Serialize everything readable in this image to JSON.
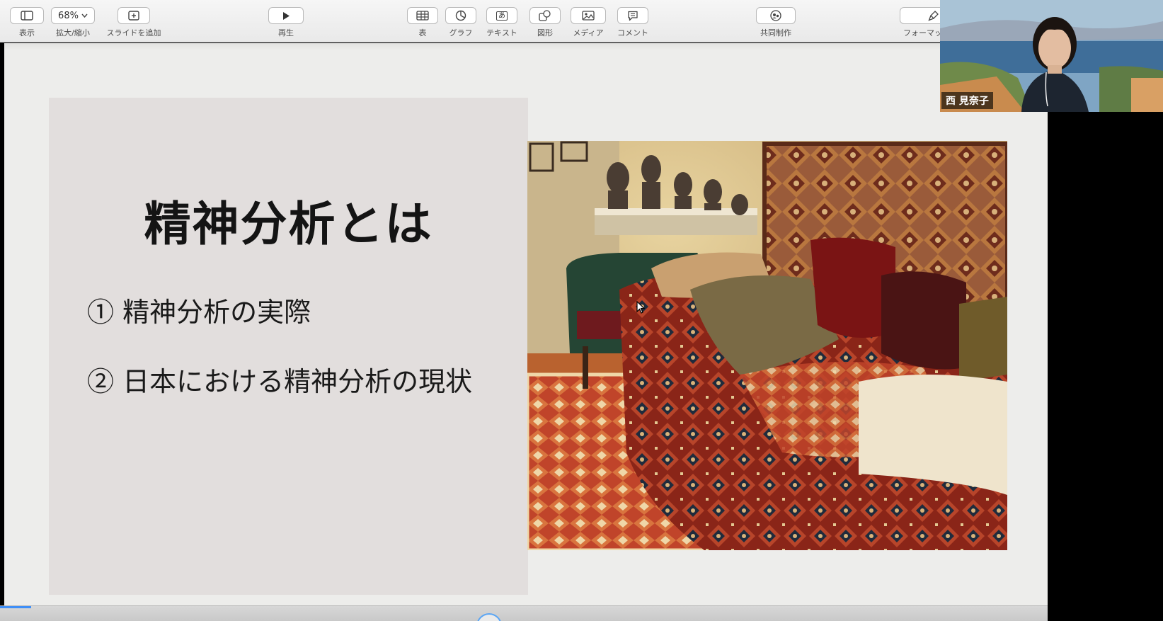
{
  "toolbar": {
    "view_label": "表示",
    "zoom_value": "68%",
    "zoom_label": "拡大/縮小",
    "add_slide_label": "スライドを追加",
    "play_label": "再生",
    "table_label": "表",
    "chart_label": "グラフ",
    "text_label": "テキスト",
    "text_icon_glyph": "あ",
    "shape_label": "図形",
    "media_label": "メディア",
    "comment_label": "コメント",
    "collaborate_label": "共同制作",
    "format_label": "フォーマッ"
  },
  "slide": {
    "title": "精神分析とは",
    "bullets": [
      "① 精神分析の実際",
      "② 日本における精神分析の現状"
    ]
  },
  "video": {
    "participant_name": "西 見奈子"
  },
  "progress": {
    "fraction": 0.03
  },
  "colors": {
    "panel": "#e2dedd",
    "canvas": "#ededeb",
    "accent": "#3f8ff7"
  }
}
